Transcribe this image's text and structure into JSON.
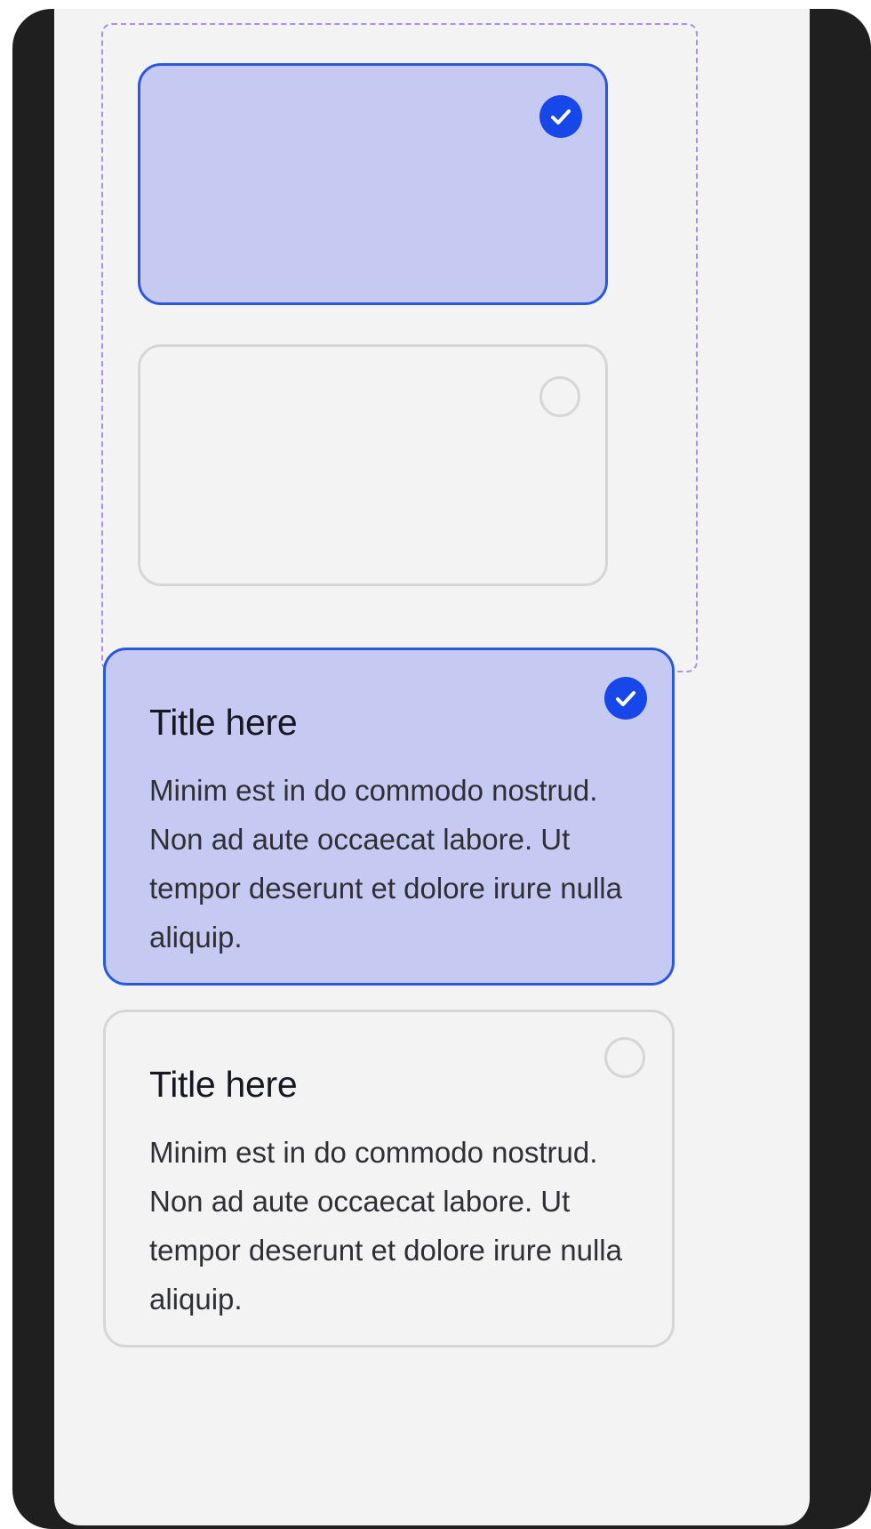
{
  "colors": {
    "frame": "#1f1f1f",
    "panel": "#f3f3f4",
    "selected_fill": "#c6caf2",
    "selected_border": "#2a58dd",
    "check_fill": "#1747e8",
    "unselected_border": "#d6d6d8",
    "dashed_outline": "#a88ef2"
  },
  "icons": {
    "selected": "check-circle-icon",
    "unselected": "radio-empty-icon"
  },
  "cards": [
    {
      "state": "selected",
      "title": "",
      "body": ""
    },
    {
      "state": "unselected",
      "title": "",
      "body": ""
    },
    {
      "state": "selected",
      "title": "Title here",
      "body": "Minim est in do commodo nostrud. Non ad aute occaecat labore. Ut tempor deserunt et dolore irure nulla aliquip."
    },
    {
      "state": "unselected",
      "title": "Title here",
      "body": "Minim est in do commodo nostrud. Non ad aute occaecat labore. Ut tempor deserunt et dolore irure nulla aliquip."
    }
  ]
}
